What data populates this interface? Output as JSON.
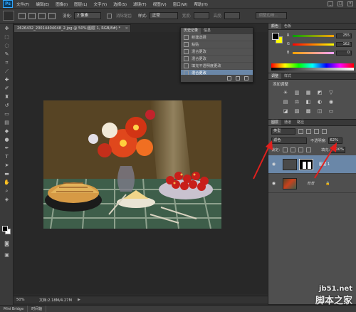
{
  "app": {
    "logo": "Ps"
  },
  "menus": [
    "文件(F)",
    "编辑(E)",
    "图像(I)",
    "图层(L)",
    "文字(Y)",
    "选择(S)",
    "滤镜(T)",
    "视图(V)",
    "窗口(W)",
    "帮助(H)"
  ],
  "options": {
    "feather_label": "羽化:",
    "feather_value": "2 像素",
    "antialias_label": "消除锯齿",
    "style_label": "样式:",
    "style_value": "正常",
    "width_label": "宽度:",
    "height_label": "高度:",
    "refine_edge": "调整边缘..."
  },
  "document": {
    "tab_title": "2626432_20014404048_2.jpg @ 50%(图层 1, RGB/8#) *",
    "zoom": "50%",
    "doc_info": "文档:2.18M/4.27M"
  },
  "history": {
    "tabs": [
      "历史记录",
      "信息"
    ],
    "items": [
      "新建选择",
      "粘贴",
      "混合更改",
      "混合更改",
      "填充不透明度更改",
      "混合更改"
    ],
    "selected_index": 5
  },
  "color_panel": {
    "tabs": [
      "颜色",
      "色板"
    ],
    "channels": [
      {
        "label": "R",
        "value": "255"
      },
      {
        "label": "G",
        "value": "162"
      },
      {
        "label": "B",
        "value": "0"
      }
    ]
  },
  "adjustments": {
    "tabs": [
      "调整",
      "样式"
    ],
    "title": "添加调整"
  },
  "layers_panel": {
    "tabs": [
      "图层",
      "通道",
      "路径"
    ],
    "filter_kind": "类型",
    "blend_mode": "滤色",
    "opacity_label": "不透明度:",
    "opacity_value": "62%",
    "lock_label": "锁定:",
    "fill_label": "填充:",
    "fill_value": "100%",
    "layers": [
      {
        "name": "图层 1",
        "selected": true
      },
      {
        "name": "背景",
        "selected": false
      }
    ]
  },
  "bottom_bar": {
    "tabs": [
      "Mini Bridge",
      "时间轴"
    ]
  },
  "watermark": {
    "url": "jb51.net",
    "text": "脚本之家"
  },
  "colors": {
    "selection": "#6a87a8",
    "arrow": "#e0201e"
  }
}
